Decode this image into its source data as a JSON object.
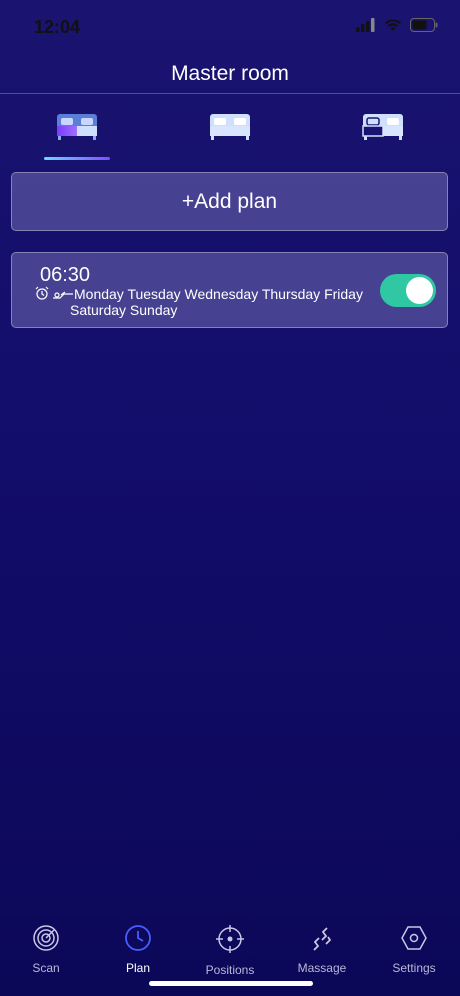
{
  "status": {
    "time": "12:04",
    "icons": [
      "signal-icon",
      "wifi-icon",
      "battery-icon"
    ]
  },
  "header": {
    "title": "Master room"
  },
  "bed_tabs": [
    {
      "icon": "bed-split-icon",
      "selected": true
    },
    {
      "icon": "bed-full-icon",
      "selected": false
    },
    {
      "icon": "bed-split-outline-icon",
      "selected": false
    }
  ],
  "add_plan": {
    "label": "+Add plan"
  },
  "plans": [
    {
      "time": "06:30",
      "days_line1": "Monday Tuesday Wednesday Thursday Friday",
      "days_line2": "Saturday Sunday",
      "icons": [
        "alarm-icon",
        "bed-position-icon"
      ],
      "enabled": true
    }
  ],
  "tab_bar": {
    "items": [
      {
        "label": "Scan",
        "icon": "scan-icon"
      },
      {
        "label": "Plan",
        "icon": "clock-icon",
        "active": true
      },
      {
        "label": "Positions",
        "icon": "crosshair-icon"
      },
      {
        "label": "Massage",
        "icon": "massage-icon"
      },
      {
        "label": "Settings",
        "icon": "hexagon-gear-icon"
      }
    ]
  },
  "colors": {
    "background": "#140f6c",
    "accent": "#2fc8a2",
    "tab_active": "#4a5cff"
  }
}
